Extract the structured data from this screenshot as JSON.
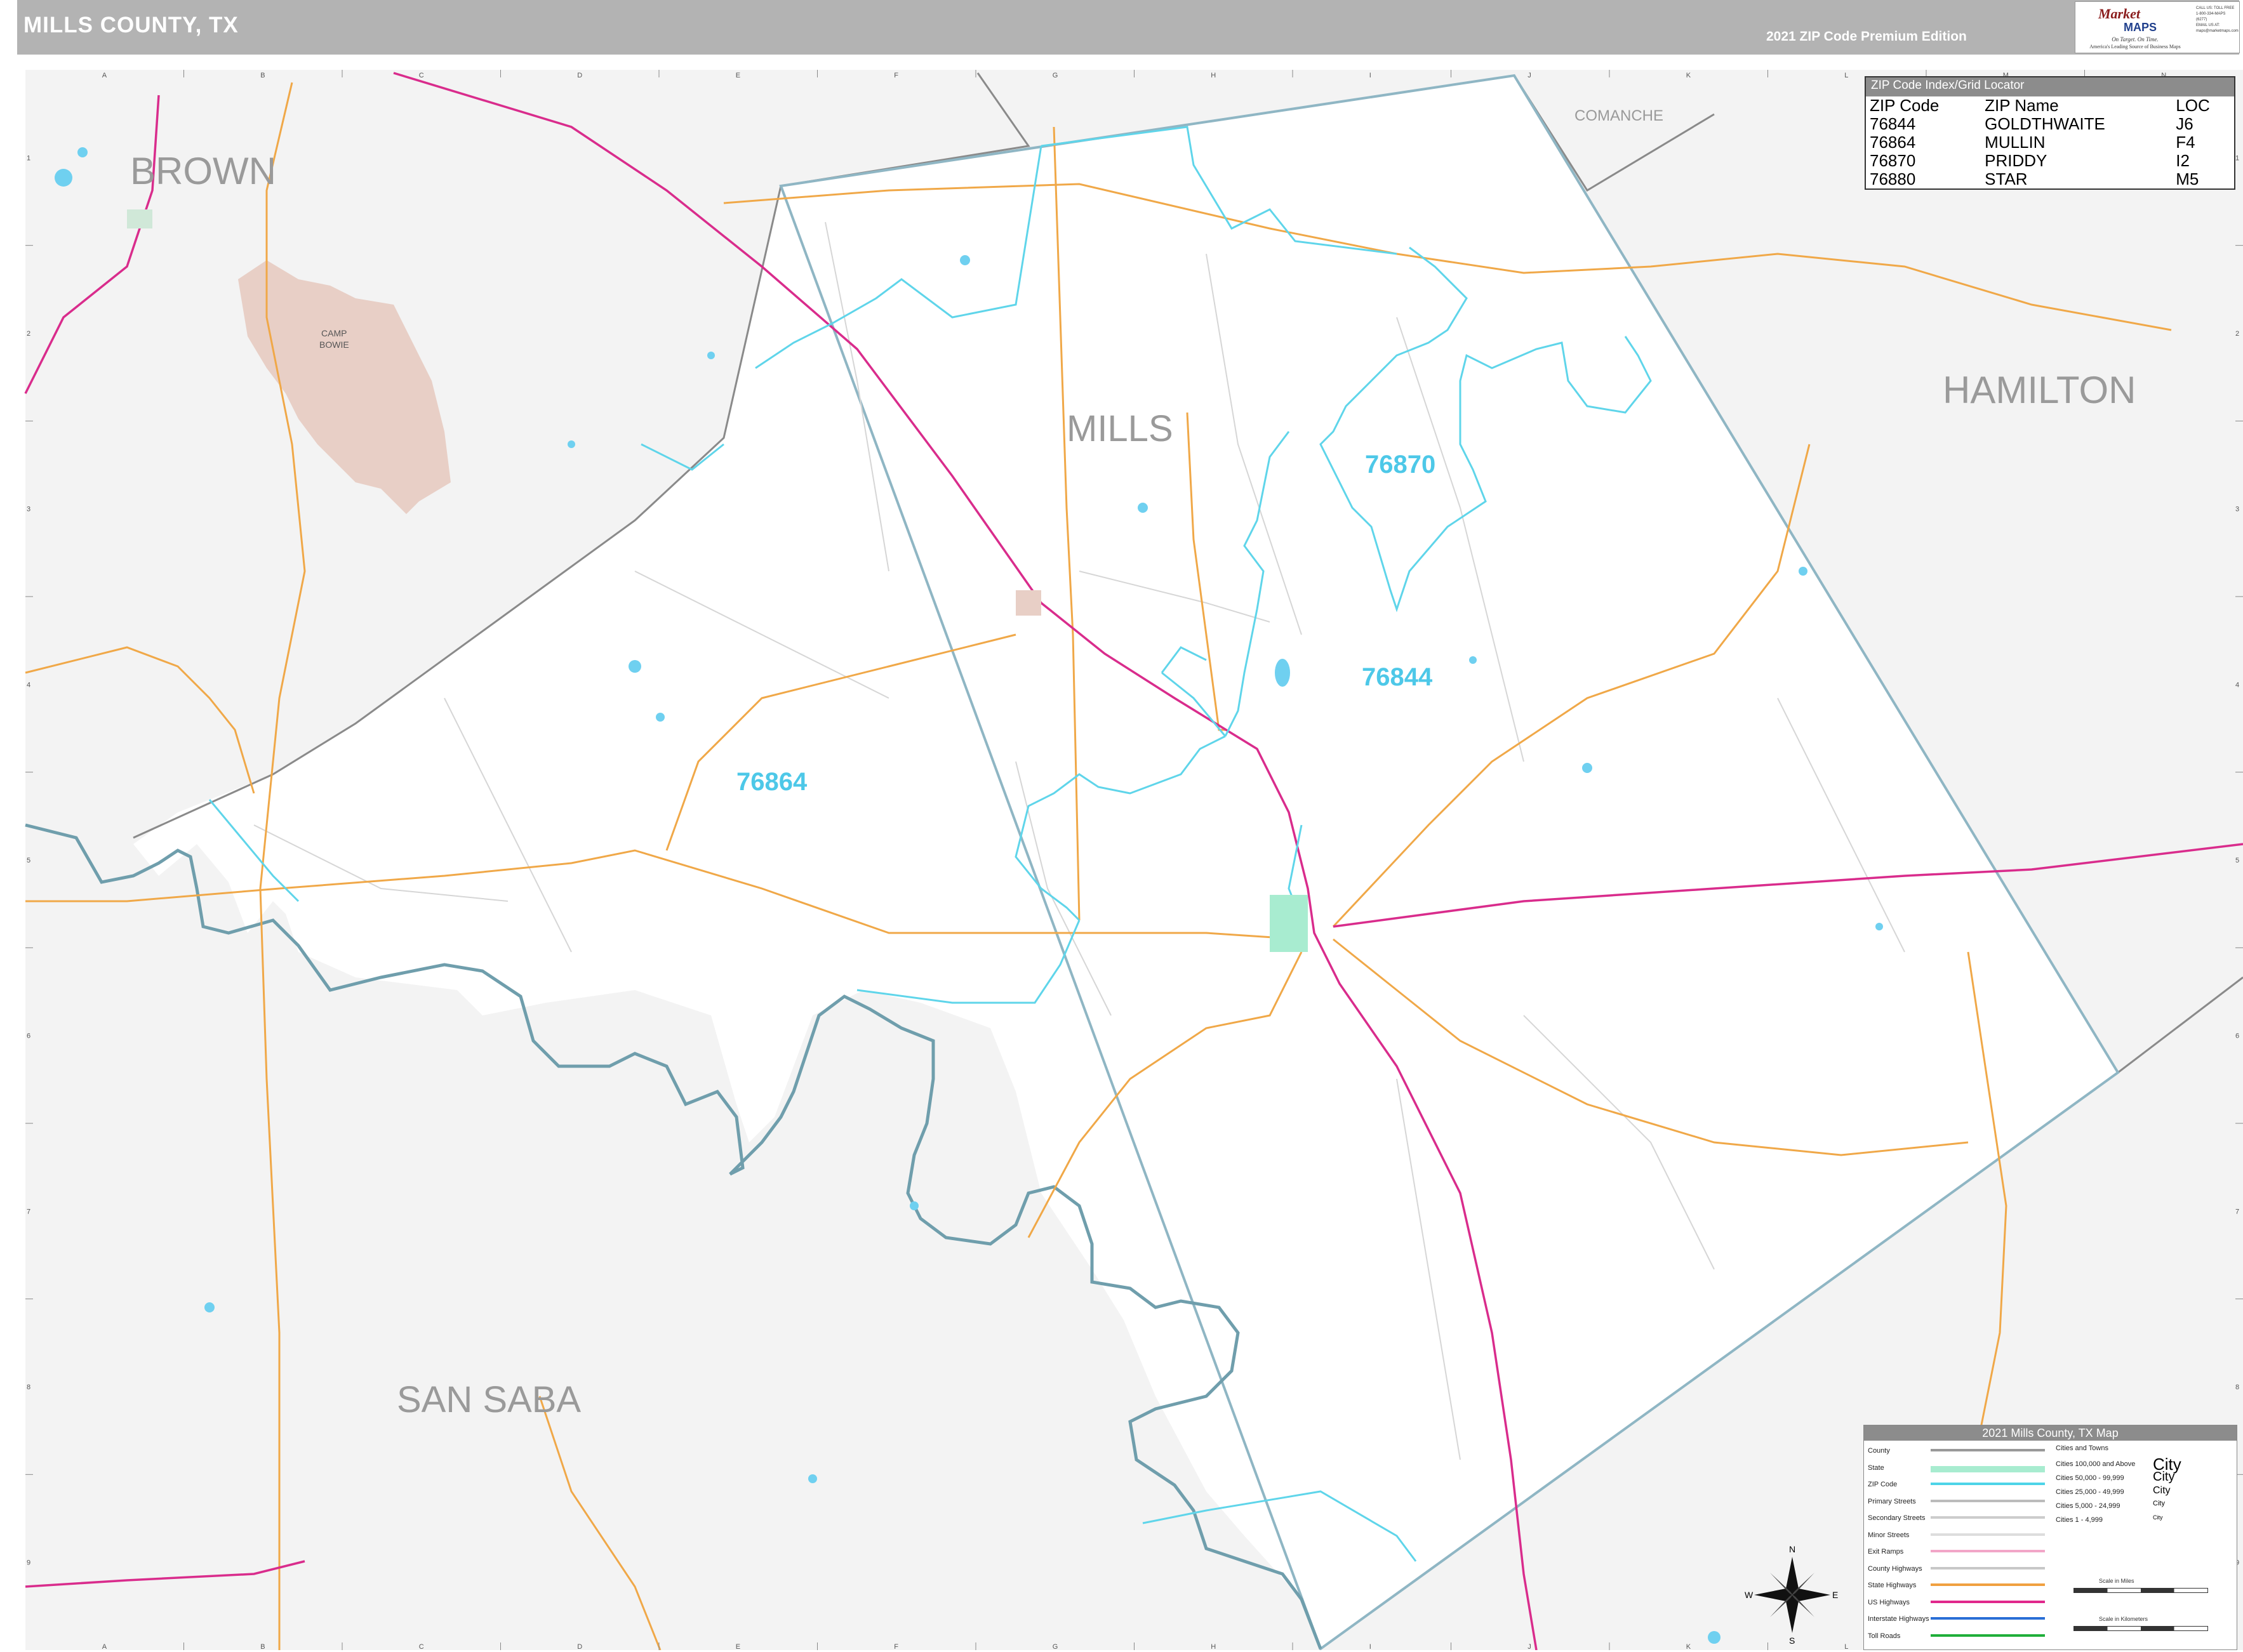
{
  "header": {
    "title": "MILLS COUNTY, TX",
    "edition": "2021 ZIP Code Premium Edition"
  },
  "logo": {
    "brand": "Market",
    "sub": "MAPS",
    "tagline": "On Target. On Time.",
    "tagline2": "America's Leading Source of Business Maps",
    "contact": [
      "CALL US: TOLL FREE",
      "1-800-334-MAPS (6277)",
      "EMAIL US AT:",
      "maps@marketmaps.com"
    ]
  },
  "grid": {
    "columns": [
      "A",
      "B",
      "C",
      "D",
      "E",
      "F",
      "G",
      "H",
      "I",
      "J",
      "K",
      "L",
      "M",
      "N"
    ],
    "rows": [
      "1",
      "2",
      "3",
      "4",
      "5",
      "6",
      "7",
      "8",
      "9"
    ]
  },
  "counties": {
    "brown": "BROWN",
    "comanche": "COMANCHE",
    "hamilton": "HAMILTON",
    "mills": "MILLS",
    "san_saba": "SAN SABA"
  },
  "places": {
    "camp_bowie_1": "CAMP",
    "camp_bowie_2": "BOWIE"
  },
  "zip_labels": {
    "z76870": "76870",
    "z76844": "76844",
    "z76864": "76864"
  },
  "zip_index": {
    "title": "ZIP Code Index/Grid Locator",
    "columns": [
      "ZIP Code",
      "ZIP Name",
      "LOC"
    ],
    "rows": [
      [
        "76844",
        "GOLDTHWAITE",
        "J6"
      ],
      [
        "76864",
        "MULLIN",
        "F4"
      ],
      [
        "76870",
        "PRIDDY",
        "I2"
      ],
      [
        "76880",
        "STAR",
        "M5"
      ]
    ]
  },
  "legend": {
    "title": "2021 Mills County, TX Map",
    "items": [
      {
        "label": "County",
        "color": "#999999"
      },
      {
        "label": "State",
        "color": "#a8ecd0"
      },
      {
        "label": "ZIP Code",
        "color": "#4dd4e8"
      },
      {
        "label": "Primary Streets",
        "color": "#bbbbbb"
      },
      {
        "label": "Secondary Streets",
        "color": "#cccccc"
      },
      {
        "label": "Minor Streets",
        "color": "#dddddd"
      },
      {
        "label": "Exit Ramps",
        "color": "#f2a6c8"
      },
      {
        "label": "County Highways",
        "color": "#c8c8c8"
      },
      {
        "label": "State Highways",
        "color": "#f0a040"
      },
      {
        "label": "US Highways",
        "color": "#e0288c"
      },
      {
        "label": "Interstate Highways",
        "color": "#2a6fd6"
      },
      {
        "label": "Toll Roads",
        "color": "#1fae3a"
      }
    ],
    "cities_title": "Cities and Towns",
    "cities": [
      {
        "label": "Cities 100,000 and Above",
        "sample": "City"
      },
      {
        "label": "Cities 50,000 - 99,999",
        "sample": "City"
      },
      {
        "label": "Cities 25,000 - 49,999",
        "sample": "City"
      },
      {
        "label": "Cities 5,000 - 24,999",
        "sample": "City"
      },
      {
        "label": "Cities 1 - 4,999",
        "sample": "City"
      }
    ],
    "scale_miles": "Scale in Miles",
    "scale_km": "Scale in Kilometers"
  },
  "compass": {
    "n": "N",
    "s": "S",
    "e": "E",
    "w": "W"
  },
  "colors": {
    "header_bg": "#b3b3b3",
    "outside_county": "#f3f3f3",
    "county_border": "#8fb6c4",
    "zip_line": "#5fd5ea",
    "us_highway": "#d92c8c",
    "state_highway": "#f0a848",
    "river": "#6f9eac",
    "camp_bowie": "#e8cfc6",
    "water": "#6fd0f0"
  }
}
